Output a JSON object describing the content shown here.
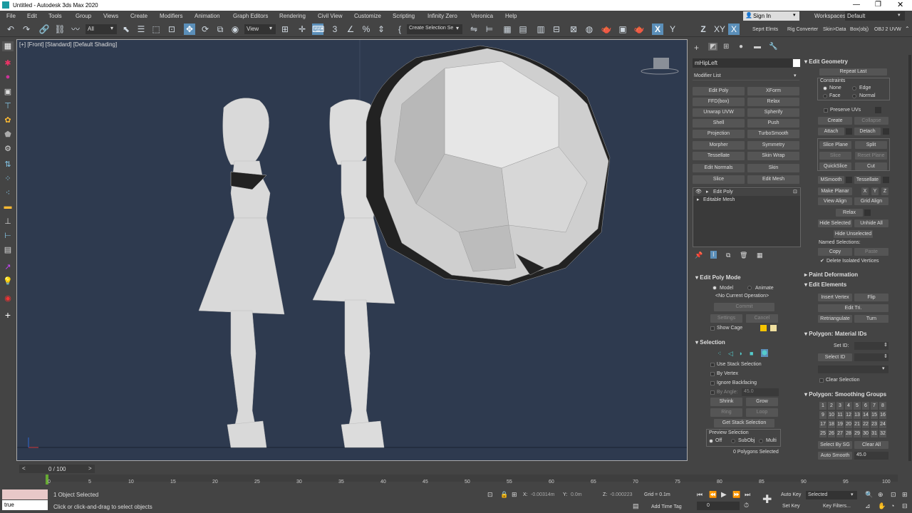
{
  "title": "Untitled - Autodesk 3ds Max 2020",
  "menu": [
    "File",
    "Edit",
    "Tools",
    "Group",
    "Views",
    "Create",
    "Modifiers",
    "Animation",
    "Graph Editors",
    "Rendering",
    "Civil View",
    "Customize",
    "Scripting",
    "Infinity Zero",
    "Veronica",
    "Help"
  ],
  "signin": "Sign In",
  "workspaces_label": "Workspaces:",
  "workspaces_value": "Default",
  "toolbar": {
    "filter": "All",
    "view": "View",
    "selection_set": "Create Selection Se",
    "axes": [
      "X",
      "Y",
      "XY"
    ],
    "plugins": [
      "Seprt Elmts",
      "Rig Converter",
      "Skin>Data",
      "Box(obj)",
      "OBJ 2 UVW"
    ]
  },
  "viewport_label": "[+] [Front] [Standard] [Default Shading]",
  "object_name": "mHipLeft",
  "modifier_list": "Modifier List",
  "modifier_buttons": [
    "Edit Poly",
    "XForm",
    "FFD(box)",
    "Relax",
    "Unwrap UVW",
    "Spherify",
    "Shell",
    "Push",
    "Projection",
    "TurboSmooth",
    "Morpher",
    "Symmetry",
    "Tessellate",
    "Skin Wrap",
    "Edit Normals",
    "Skin",
    "Slice",
    "Edit Mesh"
  ],
  "stack": [
    "Edit Poly",
    "Editable Mesh"
  ],
  "edit_poly_mode": {
    "title": "Edit Poly Mode",
    "model": "Model",
    "animate": "Animate",
    "no_op": "<No Current Operation>",
    "commit": "Commit",
    "settings": "Settings",
    "cancel": "Cancel",
    "show_cage": "Show Cage"
  },
  "selection": {
    "title": "Selection",
    "use_stack": "Use Stack Selection",
    "by_vertex": "By Vertex",
    "ignore_backfacing": "Ignore Backfacing",
    "by_angle": "By Angle:",
    "angle": "45.0",
    "shrink": "Shrink",
    "grow": "Grow",
    "ring": "Ring",
    "loop": "Loop",
    "get_stack": "Get Stack Selection",
    "preview": "Preview Selection",
    "off": "Off",
    "subobj": "SubObj",
    "multi": "Multi",
    "status": "0 Polygons Selected"
  },
  "edit_geometry": {
    "title": "Edit Geometry",
    "repeat_last": "Repeat Last",
    "constraints": "Constraints",
    "none": "None",
    "edge": "Edge",
    "face": "Face",
    "normal": "Normal",
    "preserve_uvs": "Preserve UVs",
    "create": "Create",
    "collapse": "Collapse",
    "attach": "Attach",
    "detach": "Detach",
    "slice_plane": "Slice Plane",
    "split": "Split",
    "slice": "Slice",
    "reset_plane": "Reset Plane",
    "quickslice": "QuickSlice",
    "cut": "Cut",
    "msmooth": "MSmooth",
    "tessellate": "Tessellate",
    "make_planar": "Make Planar",
    "x": "X",
    "y": "Y",
    "z": "Z",
    "view_align": "View Align",
    "grid_align": "Grid Align",
    "relax": "Relax",
    "hide_selected": "Hide Selected",
    "unhide_all": "Unhide All",
    "hide_unselected": "Hide Unselected",
    "named_selections": "Named Selections:",
    "copy": "Copy",
    "paste": "Paste",
    "delete_isolated": "Delete Isolated Vertices"
  },
  "paint_deformation": "Paint Deformation",
  "edit_elements": {
    "title": "Edit Elements",
    "insert_vertex": "Insert Vertex",
    "flip": "Flip",
    "edit_tri": "Edit Tri.",
    "retriangulate": "Retriangulate",
    "turn": "Turn"
  },
  "material_ids": {
    "title": "Polygon: Material IDs",
    "set_id": "Set ID:",
    "select_id": "Select ID",
    "clear_selection": "Clear Selection"
  },
  "smoothing": {
    "title": "Polygon: Smoothing Groups",
    "groups": [
      "1",
      "2",
      "3",
      "4",
      "5",
      "6",
      "7",
      "8",
      "9",
      "10",
      "11",
      "12",
      "13",
      "14",
      "15",
      "16",
      "17",
      "18",
      "19",
      "20",
      "21",
      "22",
      "23",
      "24",
      "25",
      "26",
      "27",
      "28",
      "29",
      "30",
      "31",
      "32"
    ],
    "select_by_sg": "Select By SG",
    "clear_all": "Clear All",
    "auto_smooth": "Auto Smooth",
    "auto_value": "45.0"
  },
  "timeline": {
    "frame": "0 / 100",
    "ticks": [
      "0",
      "5",
      "10",
      "15",
      "20",
      "25",
      "30",
      "35",
      "40",
      "45",
      "50",
      "55",
      "60",
      "65",
      "70",
      "75",
      "80",
      "85",
      "90",
      "95",
      "100"
    ]
  },
  "status": {
    "maxscript": "true",
    "selected": "1 Object Selected",
    "prompt": "Click or click-and-drag to select objects",
    "x_label": "X:",
    "x": "-0.00314m",
    "y_label": "Y:",
    "y": "0.0m",
    "z_label": "Z:",
    "z": "-0.000223",
    "grid": "Grid = 0.1m",
    "add_time_tag": "Add Time Tag",
    "auto_key": "Auto Key",
    "selected_mode": "Selected",
    "set_key": "Set Key",
    "key_filters": "Key Filters...",
    "frame_value": "0"
  }
}
